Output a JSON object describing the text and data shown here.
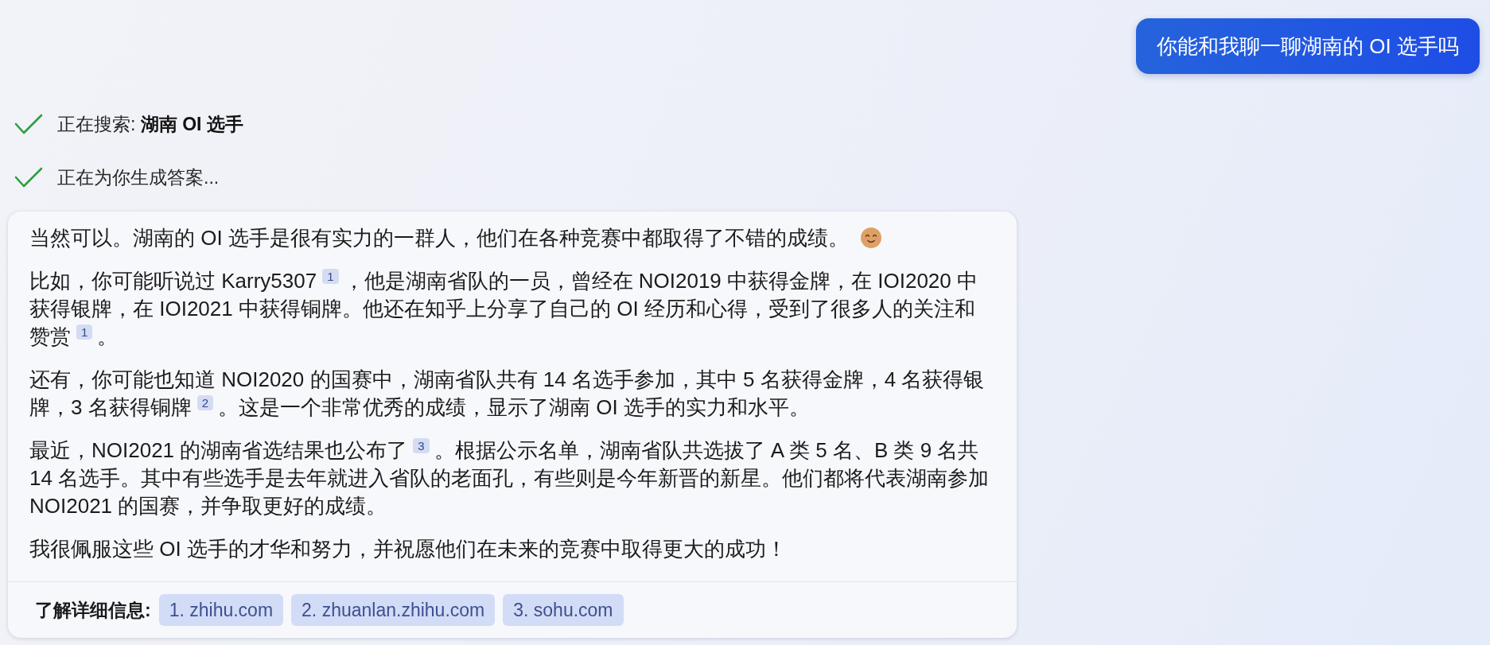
{
  "user_message": {
    "text": "你能和我聊一聊湖南的 OI 选手吗"
  },
  "progress_steps": [
    {
      "text": "正在搜索: **湖南 OI 选手**",
      "completed": true
    },
    {
      "text": "正在为你生成答案...",
      "completed": true
    }
  ],
  "answer": {
    "paragraphs": [
      {
        "parts": [
          {
            "kind": "text",
            "text": "当然可以。湖南的 OI 选手是很有实力的一群人，他们在各种竞赛中都取得了不错的成绩。 "
          },
          {
            "kind": "emoji"
          }
        ]
      },
      {
        "parts": [
          {
            "kind": "text",
            "text": "比如，你可能听说过 Karry5307"
          },
          {
            "kind": "citation",
            "text": "1"
          },
          {
            "kind": "text",
            "text": "，他是湖南省队的一员，曾经在 NOI2019 中获得金牌，在 IOI2020 中获得银牌，在 IOI2021 中获得铜牌。他还在知乎上分享了自己的 OI 经历和心得，受到了很多人的关注和赞赏"
          },
          {
            "kind": "citation",
            "text": "1"
          },
          {
            "kind": "text",
            "text": "。"
          }
        ]
      },
      {
        "parts": [
          {
            "kind": "text",
            "text": "还有，你可能也知道 NOI2020 的国赛中，湖南省队共有 14 名选手参加，其中 5 名获得金牌，4 名获得银牌，3 名获得铜牌"
          },
          {
            "kind": "citation",
            "text": "2"
          },
          {
            "kind": "text",
            "text": "。这是一个非常优秀的成绩，显示了湖南 OI 选手的实力和水平。"
          }
        ]
      },
      {
        "parts": [
          {
            "kind": "text",
            "text": "最近，NOI2021 的湖南省选结果也公布了"
          },
          {
            "kind": "citation",
            "text": "3"
          },
          {
            "kind": "text",
            "text": "。根据公示名单，湖南省队共选拔了 A 类 5 名、B 类 9 名共 14 名选手。其中有些选手是去年就进入省队的老面孔，有些则是今年新晋的新星。他们都将代表湖南参加 NOI2021 的国赛，并争取更好的成绩。"
          }
        ]
      },
      {
        "parts": [
          {
            "kind": "text",
            "text": "我很佩服这些 OI 选手的才华和努力，并祝愿他们在未来的竞赛中取得更大的成功！"
          }
        ]
      }
    ],
    "learn_more": {
      "label": "了解详细信息:",
      "links": [
        "1. zhihu.com",
        "2. zhuanlan.zhihu.com",
        "3. sohu.com"
      ]
    }
  }
}
